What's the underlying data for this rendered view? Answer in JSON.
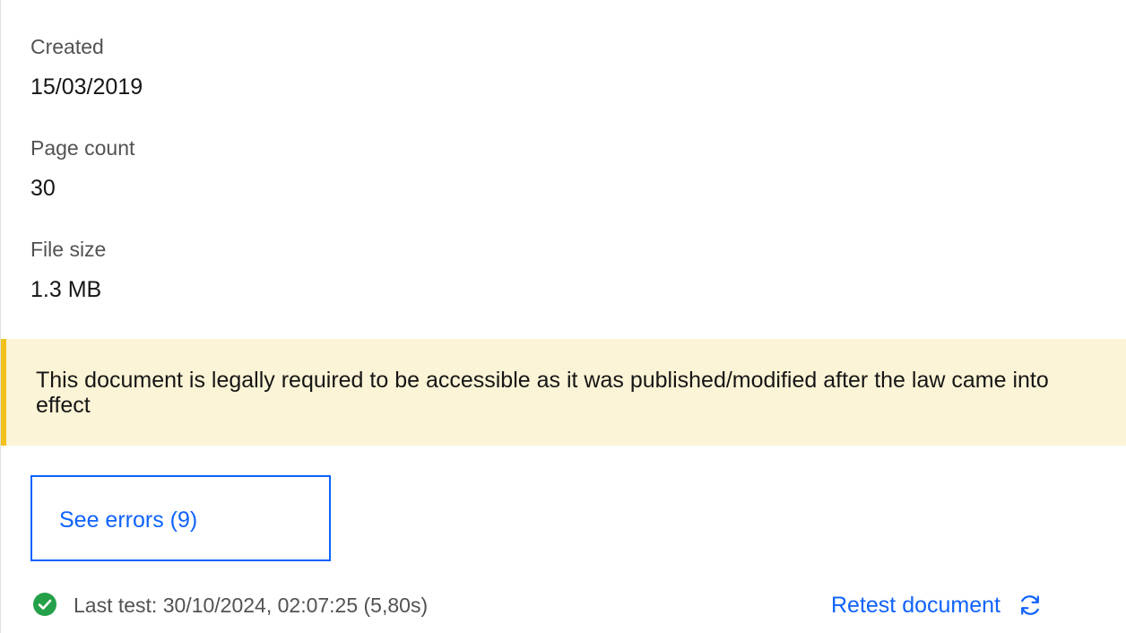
{
  "metadata": {
    "created": {
      "label": "Created",
      "value": "15/03/2019"
    },
    "page_count": {
      "label": "Page count",
      "value": "30"
    },
    "file_size": {
      "label": "File size",
      "value": "1.3 MB"
    }
  },
  "notice": {
    "text": "This document is legally required to be accessible as it was published/modified after the law came into effect",
    "accent_color": "#f1c21b",
    "background_color": "#fcf4d6"
  },
  "actions": {
    "see_errors_label": "See errors (9)",
    "retest_label": "Retest document"
  },
  "status": {
    "text": "Last test: 30/10/2024, 02:07:25 (5,80s)",
    "state": "passed",
    "icon": "check-circle-icon",
    "color": "#24a148"
  },
  "colors": {
    "link": "#0f62fe"
  }
}
